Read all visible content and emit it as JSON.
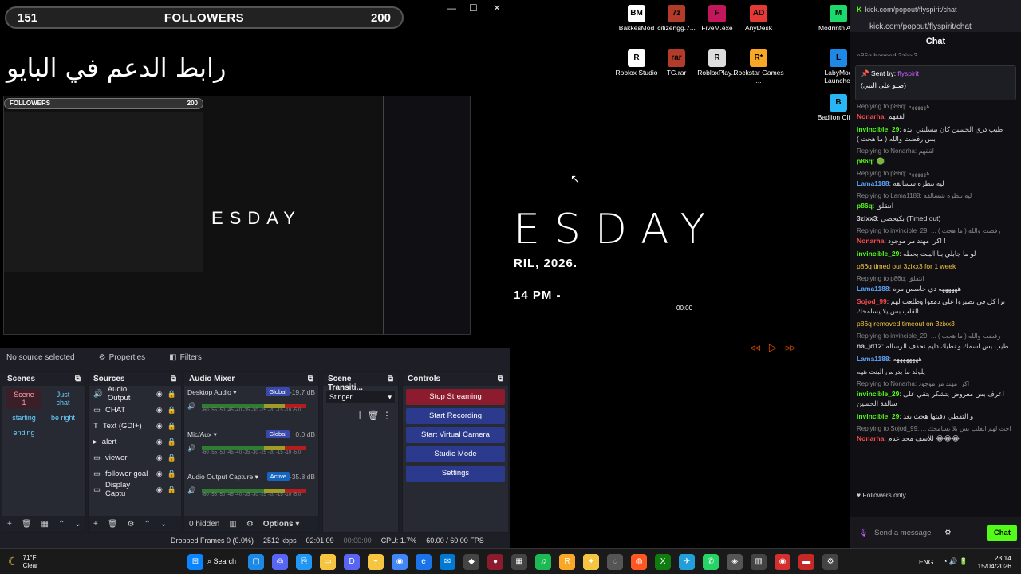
{
  "obs": {
    "followers_left": "151",
    "followers_title": "FOLLOWERS",
    "followers_right": "200",
    "arabic_banner": "رابط الدعم في البايو",
    "no_source": "No source selected",
    "properties": "Properties",
    "filters": "Filters",
    "docks": {
      "scenes": "Scenes",
      "sources": "Sources",
      "audio_mixer": "Audio Mixer",
      "scene_transitions": "Scene Transiti...",
      "controls": "Controls"
    },
    "scenes": [
      "Scene 1",
      "Just chat",
      "starting",
      "be right",
      "ending"
    ],
    "sources": [
      "Audio Output",
      "CHAT",
      "Text (GDI+)",
      "alert",
      "viewer",
      "follower goal",
      "Display Captu"
    ],
    "mixer": [
      {
        "name": "Desktop Audio",
        "badge": "Global",
        "db": "-19.7 dB"
      },
      {
        "name": "Mic/Aux",
        "badge": "Global",
        "db": "0.0 dB"
      },
      {
        "name": "Audio Output Capture",
        "badge": "Active",
        "db": "-35.8 dB"
      }
    ],
    "meter_ticks": "-60 -55 -50 -45 -40 -35 -30 -25 -20 -15 -10 -5 0",
    "transition": "Stinger",
    "controls": [
      "Stop Streaming",
      "Start Recording",
      "Start Virtual Camera",
      "Studio Mode",
      "Settings"
    ],
    "hidden": "0 hidden",
    "options": "Options",
    "status": {
      "dropped": "Dropped Frames 0 (0.0%)",
      "bitrate": "2512 kbps",
      "time1": "02:01:09",
      "time2": "00:00:00",
      "cpu": "CPU: 1.7%",
      "fps": "60.00 / 60.00 FPS"
    }
  },
  "desktop": {
    "big_text": "ESDAY",
    "date_line": "RIL, 2026.",
    "time_line": "14 PM -",
    "clock": "00:00",
    "icons": [
      {
        "label": "BakkesMod",
        "color": "#ffffff",
        "text": "BM"
      },
      {
        "label": "citizengg.7...",
        "color": "#b23b2a",
        "text": "7z"
      },
      {
        "label": "FiveM.exe",
        "color": "#c2185b",
        "text": "F"
      },
      {
        "label": "AnyDesk",
        "color": "#e53935",
        "text": "AD"
      },
      {
        "label": "Modrinth App",
        "color": "#1bd96a",
        "text": "M"
      },
      {
        "label": "Roblox Studio",
        "color": "#ffffff",
        "text": "R"
      },
      {
        "label": "TG.rar",
        "color": "#b23b2a",
        "text": "rar"
      },
      {
        "label": "RobloxPlay...",
        "color": "#dddddd",
        "text": "R"
      },
      {
        "label": "Rockstar Games ...",
        "color": "#f9a825",
        "text": "R*"
      },
      {
        "label": "LabyMod Launcher",
        "color": "#1e88e5",
        "text": "L"
      },
      {
        "label": "Badlion Client",
        "color": "#29b6f6",
        "text": "B"
      }
    ]
  },
  "chat": {
    "url": "kick.com/popout/flyspirit/chat",
    "header": "Chat",
    "banned_line": "p86q banned 3zixx3",
    "pinned_by": "Sent by",
    "pinned_user": "flyspirit",
    "pinned_msg": "(صلو على النبي)",
    "messages": [
      {
        "reply": "Replying to p86q: ههههههه",
        "user": "Nonarha",
        "uclass": "r",
        "text": "لققهم"
      },
      {
        "reply": "",
        "user": "invincible_29",
        "uclass": "g",
        "text": "طيب دري الحسين كان بيسلبني ايده بس رفضت والله ( ما هحت )"
      },
      {
        "reply": "Replying to Nonarha: لققهم",
        "user": "p86q",
        "uclass": "g",
        "text": "🟢"
      },
      {
        "reply": "Replying to p86q: ههههههه",
        "user": "Lama1188",
        "uclass": "b",
        "text": "ليه تنظره شسالفه"
      },
      {
        "reply": "Replying to Lama1188: ليه تنظره شسالفه",
        "user": "p86q",
        "uclass": "g",
        "text": "انتقلق"
      },
      {
        "reply": "",
        "user": "3zixx3",
        "uclass": "s",
        "text": "بكيحصي (Timed out)"
      },
      {
        "reply": "Replying to invincible_29: ... رفضت والله ( ما هحت )",
        "user": "Nonarha",
        "uclass": "r",
        "text": "اكرا مهند مر موجود !"
      },
      {
        "reply": "",
        "user": "invincible_29",
        "uclass": "g",
        "text": "لو ما جابلي بنا البنت بحطه"
      },
      {
        "reply": "",
        "user": "",
        "uclass": "y",
        "text": "p86q timed out 3zixx3 for 1 week"
      },
      {
        "reply": "Replying to p86q: انتقلق",
        "user": "Lama1188",
        "uclass": "b",
        "text": "ههههههه دي خاسس مره"
      },
      {
        "reply": "",
        "user": "Sojod_99",
        "uclass": "r",
        "text": "ترا كل في تصبروا على دمعوا وطلعت لهم القلب بس يلا يسامحك"
      },
      {
        "reply": "",
        "user": "",
        "uclass": "y",
        "text": "p86q removed timeout on 3zixx3"
      },
      {
        "reply": "Replying to invincible_29: ... رفضت والله ( ما هحت )",
        "user": "na_jd12",
        "uclass": "s",
        "text": "طيب بس اسمك و نطيك دايم نحذف الرساله"
      },
      {
        "reply": "",
        "user": "Lama1188",
        "uclass": "b",
        "text": "ههههههههه"
      },
      {
        "reply": "",
        "user": "",
        "uclass": "s",
        "text": "يلولد ما يدرس البنت ههه"
      },
      {
        "reply": "Replying to Nonarha: اكرا مهند مر موجود !",
        "user": "invincible_29",
        "uclass": "g",
        "text": "اعرف بس معروض يتشكر بتقي على سالفة الحسين"
      },
      {
        "reply": "",
        "user": "invincible_29",
        "uclass": "g",
        "text": "و التفطي دفيتها هجت بعد"
      },
      {
        "reply": "Replying to Sojod_99: ... احت لهم القلب بس يلا يسامحك",
        "user": "Nonarha",
        "uclass": "r",
        "text": "للأسف محد عدم 😂😂😂"
      }
    ],
    "followers_only": "Followers only",
    "send_placeholder": "Send a message",
    "chat_button": "Chat"
  },
  "taskbar": {
    "weather_temp": "71°F",
    "weather_desc": "Clear",
    "search": "Search",
    "lang": "ENG",
    "time": "23:14",
    "date": "15/04/2026"
  }
}
